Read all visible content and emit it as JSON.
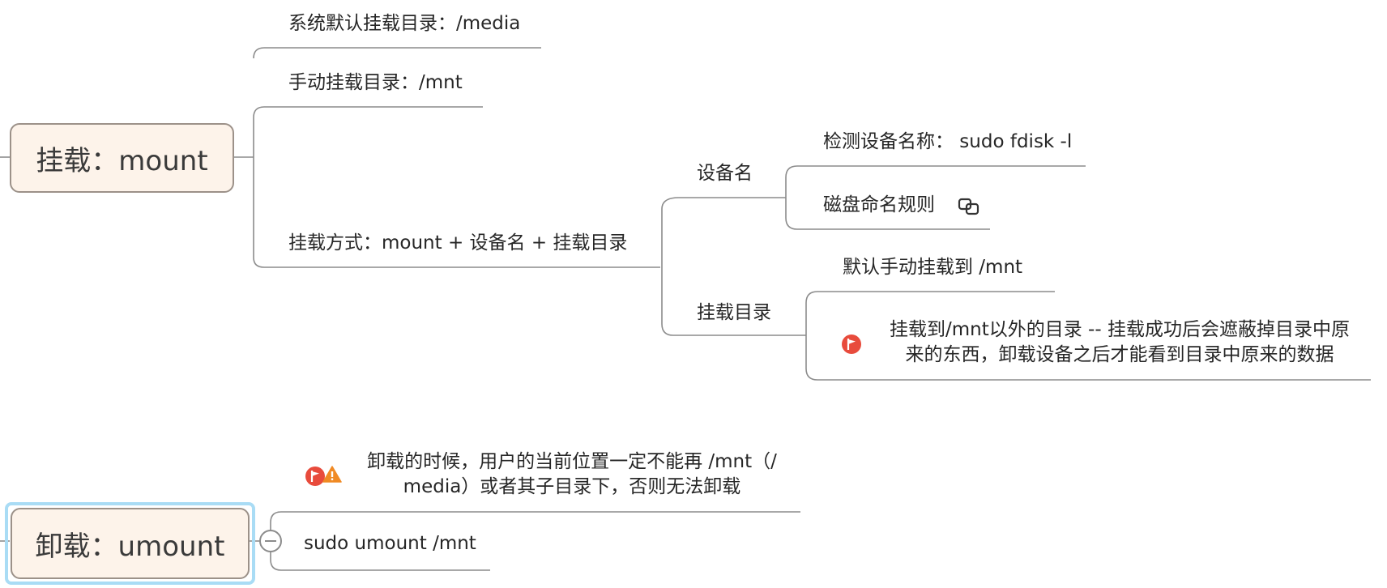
{
  "mindmap": {
    "mount": {
      "title": "挂载：mount",
      "default_dir": "系统默认挂载目录：/media",
      "manual_dir": "手动挂载目录：/mnt",
      "method": "挂载方式：mount + 设备名 + 挂载目录",
      "device": {
        "label": "设备名",
        "detect": "检测设备名称：  sudo fdisk -l",
        "naming_rule": "磁盘命名规则"
      },
      "mount_dir": {
        "label": "挂载目录",
        "default_manual": "默认手动挂载到    /mnt",
        "warning_line1": "挂载到/mnt以外的目录 -- 挂载成功后会遮蔽掉目录中原",
        "warning_line2": "来的东西，卸载设备之后才能看到目录中原来的数据"
      }
    },
    "umount": {
      "title": "卸载：umount",
      "note_line1": "卸载的时候，用户的当前位置一定不能再 /mnt（/",
      "note_line2": "media）或者其子目录下，否则无法卸载",
      "command": "sudo umount /mnt"
    }
  },
  "colors": {
    "topic_fill": "#fdf3ea",
    "topic_border": "#9c9189",
    "line": "#8c8c8c",
    "selection": "#a9dcf5",
    "flag": "#e84b3c",
    "warning": "#f08a24"
  },
  "icons": [
    "link-icon",
    "red-flag-icon",
    "warning-icon",
    "collapse-icon"
  ]
}
